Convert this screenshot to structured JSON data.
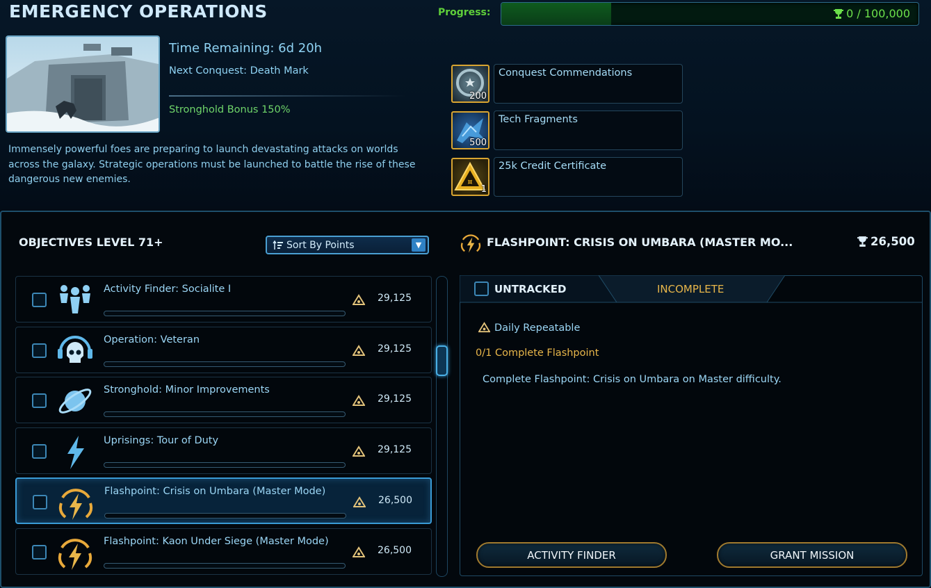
{
  "header": {
    "title": "EMERGENCY OPERATIONS",
    "progress_label": "Progress:",
    "progress_text": "0 / 100,000",
    "progress_fraction": 0.0
  },
  "event": {
    "time_remaining": "Time Remaining: 6d 20h",
    "next_conquest": "Next Conquest: Death Mark",
    "stronghold_bonus": "Stronghold Bonus 150%",
    "description": "Immensely powerful foes are preparing to launch devastating attacks on worlds across the galaxy. Strategic operations must be launched to battle the rise of these dangerous new enemies."
  },
  "rewards": [
    {
      "label": "Conquest Commendations",
      "count": "200",
      "icon": "commendation-medal-icon"
    },
    {
      "label": "Tech Fragments",
      "count": "500",
      "icon": "tech-fragment-icon"
    },
    {
      "label": "25k Credit Certificate",
      "count": "1",
      "icon": "credit-certificate-icon"
    }
  ],
  "objectives": {
    "title": "OBJECTIVES LEVEL 71+",
    "sort_label": "Sort By Points",
    "items": [
      {
        "name": "Activity Finder: Socialite I",
        "points": "29,125",
        "icon": "group-people-icon",
        "progress": 0
      },
      {
        "name": "Operation: Veteran",
        "points": "29,125",
        "icon": "skull-headset-icon",
        "progress": 0
      },
      {
        "name": "Stronghold: Minor Improvements",
        "points": "29,125",
        "icon": "planet-icon",
        "progress": 0
      },
      {
        "name": "Uprisings: Tour of Duty",
        "points": "29,125",
        "icon": "lightning-bolt-icon",
        "progress": 0
      },
      {
        "name": "Flashpoint: Crisis on Umbara (Master Mode)",
        "points": "26,500",
        "icon": "flashpoint-icon",
        "progress": 0
      },
      {
        "name": "Flashpoint: Kaon Under Siege (Master Mode)",
        "points": "26,500",
        "icon": "flashpoint-icon",
        "progress": 0
      }
    ]
  },
  "detail": {
    "title": "FLASHPOINT: CRISIS ON UMBARA (MASTER MO...",
    "points": "26,500",
    "tab_untracked": "UNTRACKED",
    "tab_incomplete": "INCOMPLETE",
    "repeat": "Daily Repeatable",
    "task_count": "0/1 Complete Flashpoint",
    "task_desc": "Complete Flashpoint: Crisis on Umbara on Master difficulty.",
    "btn_activity": "ACTIVITY FINDER",
    "btn_grant": "GRANT MISSION"
  },
  "colors": {
    "accent_blue": "#3a9bd6",
    "gold": "#e8b64a",
    "green": "#6ce04a"
  }
}
